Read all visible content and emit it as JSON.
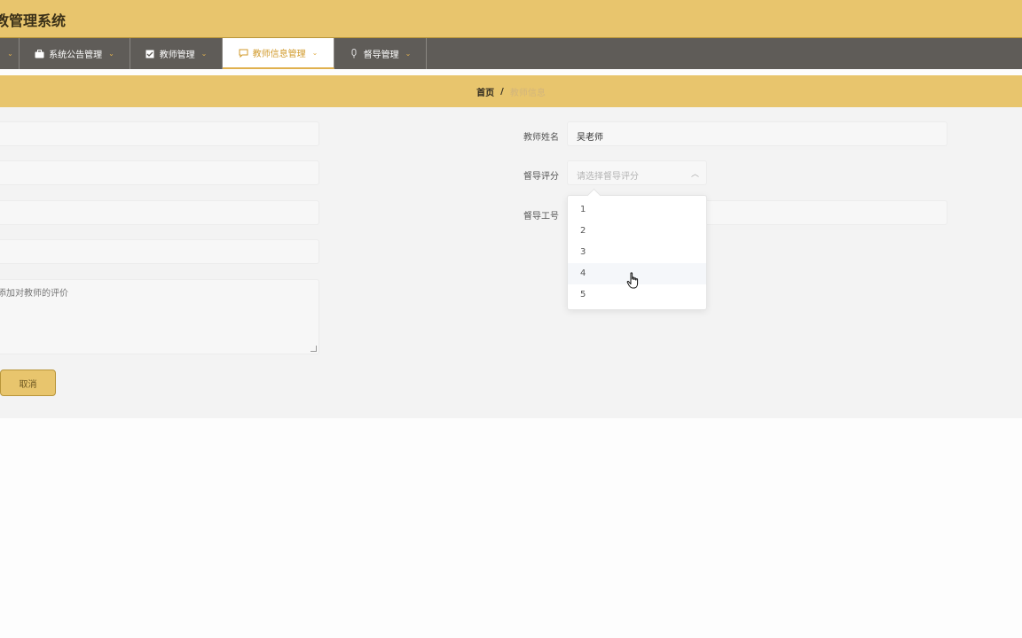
{
  "header": {
    "title": "教管理系统"
  },
  "nav": {
    "items": [
      {
        "label": "",
        "icon": "caret-icon"
      },
      {
        "label": "系统公告管理",
        "icon": "briefcase-icon"
      },
      {
        "label": "教师管理",
        "icon": "checkbox-icon"
      },
      {
        "label": "教师信息管理",
        "icon": "chat-icon",
        "active": true
      },
      {
        "label": "督导管理",
        "icon": "mic-icon"
      }
    ],
    "caret": "⌄"
  },
  "breadcrumb": {
    "home": "首页",
    "separator": "/",
    "current": "教师信息"
  },
  "form": {
    "teacher_name_label": "教师姓名",
    "teacher_name_value": "吴老师",
    "rating_label": "督导评分",
    "rating_placeholder": "请选择督导评分",
    "supervisor_id_label": "督导工号",
    "evaluation_placeholder": "添加对教师的评价",
    "cancel_label": "取消"
  },
  "rating_options": [
    "1",
    "2",
    "3",
    "4",
    "5"
  ],
  "hovered_option": "4",
  "colors": {
    "gold": "#e8c56d",
    "nav": "#5f5c58",
    "active_text": "#d19a2b"
  }
}
